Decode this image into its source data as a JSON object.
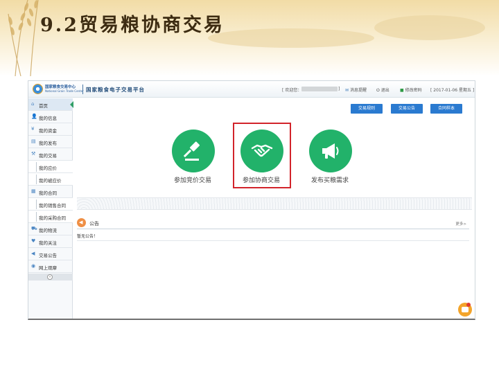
{
  "slide": {
    "title": "9.2贸易粮协商交易"
  },
  "header": {
    "logo_cn": "国家粮食交易中心",
    "logo_en": "National Grain Trade Center",
    "platform_title": "国家粮食电子交易平台",
    "welcome": "[ 欢迎您：",
    "bracket_close": "]",
    "messages": "消息提醒",
    "logout": "退出",
    "change_password": "修改密码",
    "date": "[ 2017-01-06 星期五 ]"
  },
  "sidebar": {
    "items": [
      {
        "label": "首页",
        "icon": "home-icon"
      },
      {
        "label": "我的信息",
        "icon": "user-icon"
      },
      {
        "label": "我的资金",
        "icon": "money-icon"
      },
      {
        "label": "我的发布",
        "icon": "publish-icon"
      },
      {
        "label": "我的交易",
        "icon": "trade-icon"
      },
      {
        "label": "我的应价"
      },
      {
        "label": "我的被应价"
      },
      {
        "label": "我的合同",
        "icon": "contract-icon"
      },
      {
        "label": "我的销售合同"
      },
      {
        "label": "我的采购合同"
      },
      {
        "label": "我的物流",
        "icon": "truck-icon"
      },
      {
        "label": "我的关注",
        "icon": "heart-icon"
      },
      {
        "label": "交易公告",
        "icon": "announce-icon"
      },
      {
        "label": "网上观摩",
        "icon": "eye-icon"
      }
    ]
  },
  "toolbar": {
    "rules": "交易规则",
    "announcement": "交易公告",
    "contract_template": "合同样本"
  },
  "actions": {
    "bidding": "参加竞价交易",
    "negotiation": "参加协商交易",
    "purchase_request": "发布买粮需求"
  },
  "notice": {
    "title": "公告",
    "more": "更多>",
    "empty": "暂无公告！"
  },
  "colors": {
    "accent_green": "#22b26a",
    "primary_blue": "#2a7ad0",
    "highlight_red": "#d2232a"
  }
}
